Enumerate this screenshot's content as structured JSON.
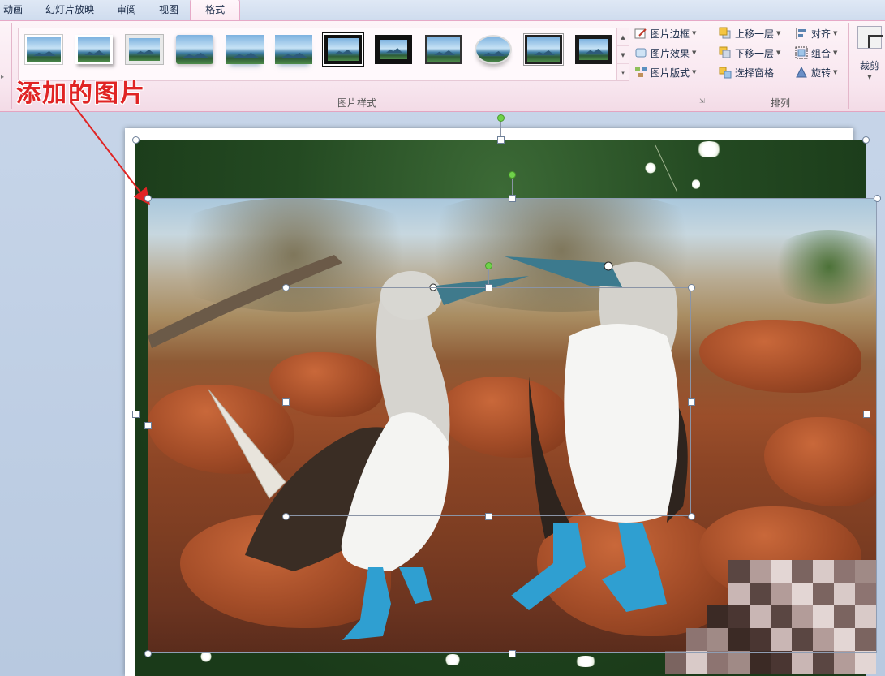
{
  "tabs": [
    {
      "label": "动画",
      "active": false
    },
    {
      "label": "幻灯片放映",
      "active": false
    },
    {
      "label": "审阅",
      "active": false
    },
    {
      "label": "视图",
      "active": false
    },
    {
      "label": "格式",
      "active": true
    }
  ],
  "ribbon": {
    "picture_styles": {
      "group_label": "图片样式",
      "commands": {
        "border": "图片边框",
        "effects": "图片效果",
        "layout": "图片版式"
      }
    },
    "arrange": {
      "group_label": "排列",
      "commands": {
        "bring_forward": "上移一层",
        "send_backward": "下移一层",
        "selection_pane": "选择窗格",
        "align": "对齐",
        "group": "组合",
        "rotate": "旋转"
      }
    },
    "size": {
      "crop": "裁剪"
    }
  },
  "annotation": {
    "text": "添加的图片",
    "color": "#e02424"
  },
  "colors": {
    "ribbon_accent": "#e3a4c0",
    "selection_handle_rotate": "#6fd24a",
    "workspace": "#c9d7ea"
  },
  "icons": {
    "border": "pencil-border-icon",
    "effects": "effects-icon",
    "layout": "layout-icon",
    "bring_forward": "bring-forward-icon",
    "send_backward": "send-backward-icon",
    "selection_pane": "selection-pane-icon",
    "align": "align-icon",
    "group": "group-icon",
    "rotate": "rotate-icon",
    "crop": "crop-icon"
  }
}
